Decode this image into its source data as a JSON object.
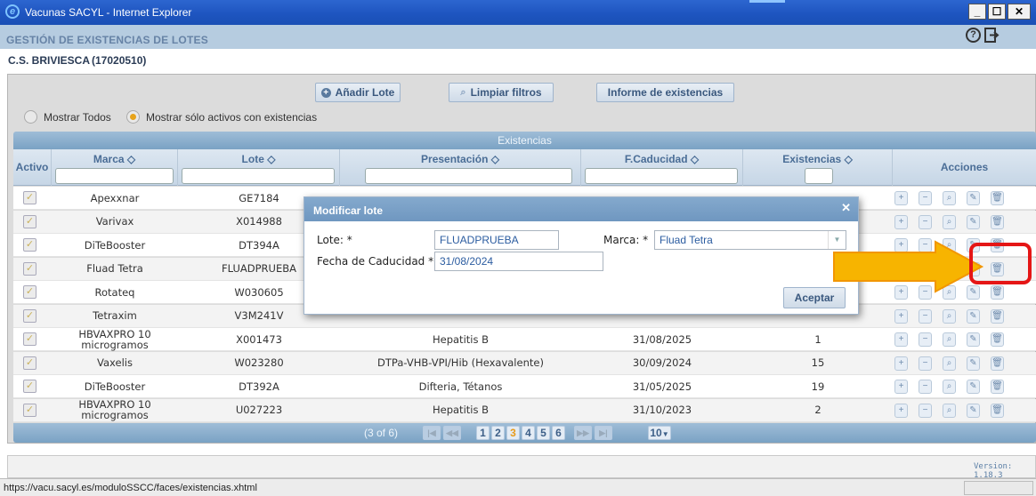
{
  "window": {
    "title": "Vacunas SACYL - Internet Explorer"
  },
  "app": {
    "title": "GESTIÓN DE EXISTENCIAS DE LOTES",
    "center_name": "C.S. BRIVIESCA",
    "center_code": "(17020510)"
  },
  "toolbar": {
    "add_lot": "Añadir Lote",
    "clear_filters": "Limpiar filtros",
    "stock_report": "Informe de existencias"
  },
  "filters": {
    "show_all": "Mostrar Todos",
    "show_active": "Mostrar sólo activos con existencias",
    "selected": "show_active"
  },
  "table": {
    "caption": "Existencias",
    "headers": {
      "active": "Activo",
      "brand": "Marca ◇",
      "lot": "Lote ◇",
      "presentation": "Presentación ◇",
      "expiry": "F.Caducidad ◇",
      "stock": "Existencias ◇",
      "actions": "Acciones"
    },
    "rows": [
      {
        "brand": "Apexxnar",
        "lot": "GE7184",
        "presentation": "",
        "expiry": "",
        "stock": ""
      },
      {
        "brand": "Varivax",
        "lot": "X014988",
        "presentation": "",
        "expiry": "",
        "stock": ""
      },
      {
        "brand": "DiTeBooster",
        "lot": "DT394A",
        "presentation": "",
        "expiry": "",
        "stock": ""
      },
      {
        "brand": "Fluad Tetra",
        "lot": "FLUADPRUEBA",
        "presentation": "",
        "expiry": "",
        "stock": ""
      },
      {
        "brand": "Rotateq",
        "lot": "W030605",
        "presentation": "",
        "expiry": "",
        "stock": ""
      },
      {
        "brand": "Tetraxim",
        "lot": "V3M241V",
        "presentation": "",
        "expiry": "",
        "stock": ""
      },
      {
        "brand": "HBVAXPRO 10 microgramos",
        "lot": "X001473",
        "presentation": "Hepatitis B",
        "expiry": "31/08/2025",
        "stock": "1"
      },
      {
        "brand": "Vaxelis",
        "lot": "W023280",
        "presentation": "DTPa-VHB-VPI/Hib (Hexavalente)",
        "expiry": "30/09/2024",
        "stock": "15"
      },
      {
        "brand": "DiTeBooster",
        "lot": "DT392A",
        "presentation": "Difteria, Tétanos",
        "expiry": "31/05/2025",
        "stock": "19"
      },
      {
        "brand": "HBVAXPRO 10 microgramos",
        "lot": "U027223",
        "presentation": "Hepatitis B",
        "expiry": "31/10/2023",
        "stock": "2"
      }
    ]
  },
  "pager": {
    "summary": "(3 of 6)",
    "pages": [
      "1",
      "2",
      "3",
      "4",
      "5",
      "6"
    ],
    "current": "3",
    "rows_per_page": "10"
  },
  "dialog": {
    "title": "Modificar lote",
    "lot_label": "Lote: *",
    "lot_value": "FLUADPRUEBA",
    "brand_label": "Marca: *",
    "brand_value": "Fluad Tetra",
    "expiry_label": "Fecha de Caducidad *",
    "expiry_value": "31/08/2024",
    "accept": "Aceptar"
  },
  "footer": {
    "version": "Version: 1.18.3"
  },
  "statusbar": {
    "url": "https://vacu.sacyl.es/moduloSSCC/faces/existencias.xhtml"
  },
  "colors": {
    "accent": "#e7a31a",
    "header": "#b6cce0",
    "highlight": "#e51616",
    "arrow": "#f7b400"
  }
}
